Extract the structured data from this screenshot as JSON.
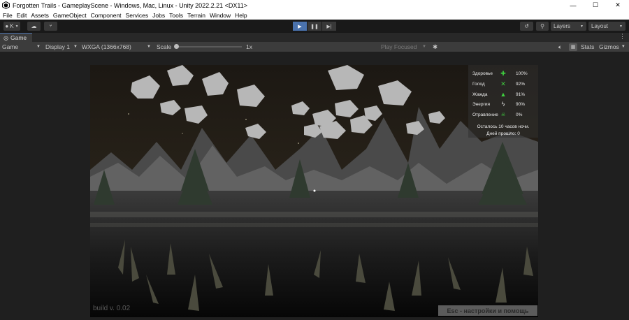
{
  "window": {
    "title": "Forgotten Trails - GameplayScene - Windows, Mac, Linux - Unity 2022.2.21 <DX11>",
    "minimize": "—",
    "maximize": "☐",
    "close": "✕"
  },
  "menu": [
    "File",
    "Edit",
    "Assets",
    "GameObject",
    "Component",
    "Services",
    "Jobs",
    "Tools",
    "Terrain",
    "Window",
    "Help"
  ],
  "toolbar": {
    "account_label": "K",
    "layers_label": "Layers",
    "layout_label": "Layout"
  },
  "tab": {
    "label": "Game"
  },
  "game_toolbar": {
    "view_mode": "Game",
    "display": "Display 1",
    "resolution": "WXGA (1366x768)",
    "scale_label": "Scale",
    "scale_value": "1x",
    "play_focused": "Play Focused",
    "stats": "Stats",
    "gizmos": "Gizmos"
  },
  "hud": {
    "stats": [
      {
        "label": "Здоровье",
        "icon": "plus-icon",
        "value": "100%"
      },
      {
        "label": "Голод",
        "icon": "cross-icon",
        "value": "92%"
      },
      {
        "label": "Жажда",
        "icon": "droplet-icon",
        "value": "91%"
      },
      {
        "label": "Энергия",
        "icon": "lightning-icon",
        "value": "90%"
      },
      {
        "label": "Отравление",
        "icon": "skull-icon",
        "value": "0%"
      }
    ],
    "time_left": "Осталось 10 часов ночи.",
    "days_passed": "Дней прошло: 0"
  },
  "game": {
    "version": "build v. 0.02",
    "esc_hint": "Esc - настройки и помощь"
  },
  "colors": {
    "accent": "#4a72ad",
    "hud_green": "#3fcf3f",
    "editor_bg": "#1e1e1e"
  }
}
